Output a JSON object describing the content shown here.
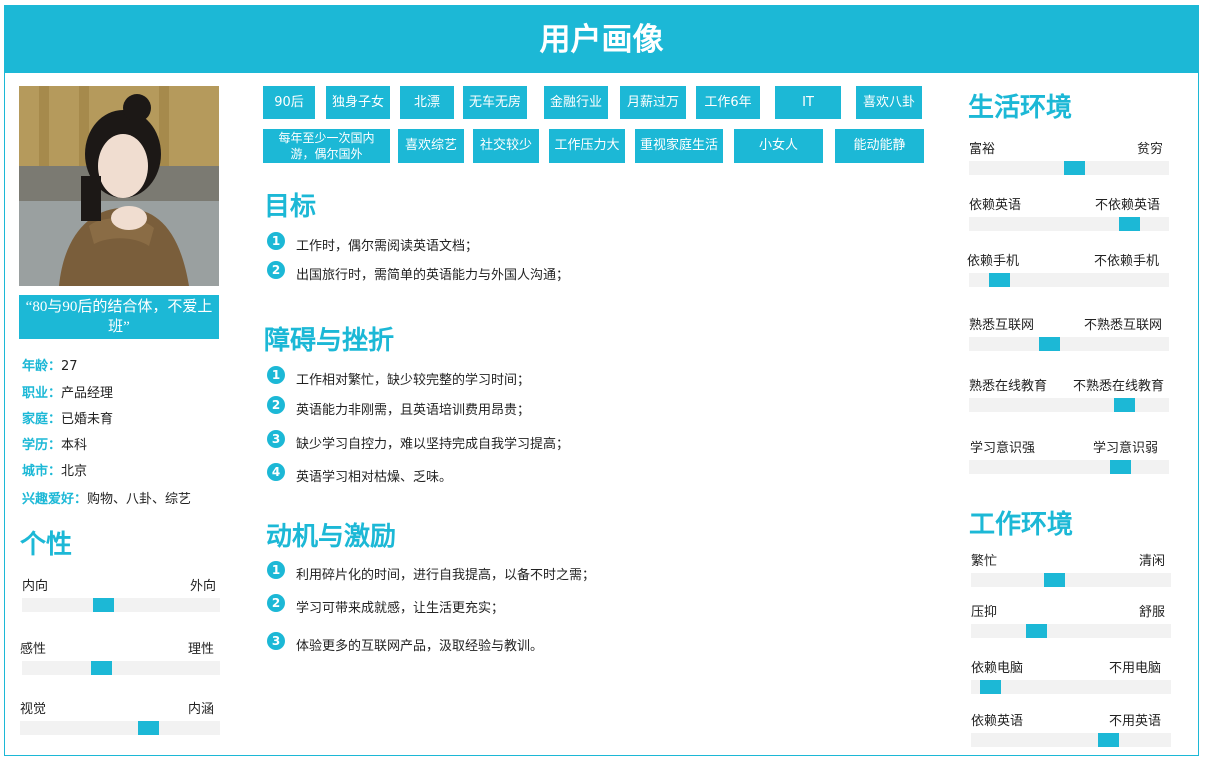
{
  "header": {
    "title": "用户画像"
  },
  "profile": {
    "quote": "“80与90后的结合体，不爱上班”",
    "info": [
      {
        "key": "年龄：",
        "value": "27"
      },
      {
        "key": "职业：",
        "value": "产品经理"
      },
      {
        "key": "家庭：",
        "value": "已婚未育"
      },
      {
        "key": "学历：",
        "value": "本科"
      },
      {
        "key": "城市：",
        "value": "北京"
      },
      {
        "key": "兴趣爱好：",
        "value": "购物、八卦、综艺"
      }
    ]
  },
  "personality": {
    "title": "个性",
    "sliders": [
      {
        "left": "内向",
        "right": "外向",
        "level": 0.4
      },
      {
        "left": "感性",
        "right": "理性",
        "level": 0.39
      },
      {
        "left": "视觉",
        "right": "内涵",
        "level": 0.66
      }
    ]
  },
  "tags": {
    "row1": [
      "90后",
      "独身子女",
      "北漂",
      "无车无房",
      "金融行业",
      "月薪过万",
      "工作6年",
      "IT",
      "喜欢八卦"
    ],
    "row2": [
      "每年至少一次国内游，偶尔国外",
      "喜欢综艺",
      "社交较少",
      "工作压力大",
      "重视家庭生活",
      "小女人",
      "能动能静"
    ]
  },
  "goals": {
    "title": "目标",
    "items": [
      {
        "num": "1",
        "text": "工作时，偶尔需阅读英语文档；"
      },
      {
        "num": "2",
        "text": "出国旅行时，需简单的英语能力与外国人沟通；"
      }
    ]
  },
  "obstacles": {
    "title": "障碍与挫折",
    "items": [
      {
        "num": "1",
        "text": "工作相对繁忙，缺少较完整的学习时间；"
      },
      {
        "num": "2",
        "text": "英语能力非刚需，且英语培训费用昂贵；"
      },
      {
        "num": "3",
        "text": "缺少学习自控力，难以坚持完成自我学习提高；"
      },
      {
        "num": "4",
        "text": "英语学习相对枯燥、乏味。"
      }
    ]
  },
  "motivation": {
    "title": "动机与激励",
    "items": [
      {
        "num": "1",
        "text": "利用碎片化的时间，进行自我提高，以备不时之需；"
      },
      {
        "num": "2",
        "text": "学习可带来成就感，让生活更充实；"
      },
      {
        "num": "3",
        "text": "体验更多的互联网产品，汲取经验与教训。"
      }
    ]
  },
  "life": {
    "title": "生活环境",
    "sliders": [
      {
        "left": "富裕",
        "right": "贫穷",
        "level": 0.53
      },
      {
        "left": "依赖英语",
        "right": "不依赖英语",
        "level": 0.84
      },
      {
        "left": "依赖手机",
        "right": "不依赖手机",
        "level": 0.11
      },
      {
        "left": "熟悉互联网",
        "right": "不熟悉互联网",
        "level": 0.39
      },
      {
        "left": "熟悉在线教育",
        "right": "不熟悉在线教育",
        "level": 0.81
      },
      {
        "left": "学习意识强",
        "right": "学习意识弱",
        "level": 0.79
      }
    ]
  },
  "work": {
    "title": "工作环境",
    "sliders": [
      {
        "left": "繁忙",
        "right": "清闲",
        "level": 0.41
      },
      {
        "left": "压抑",
        "right": "舒服",
        "level": 0.31
      },
      {
        "left": "依赖电脑",
        "right": "不用电脑",
        "level": 0.05
      },
      {
        "left": "依赖英语",
        "right": "不用英语",
        "level": 0.71
      }
    ]
  },
  "colors": {
    "accent": "#1cb8d6",
    "track": "#f2f2f2"
  }
}
